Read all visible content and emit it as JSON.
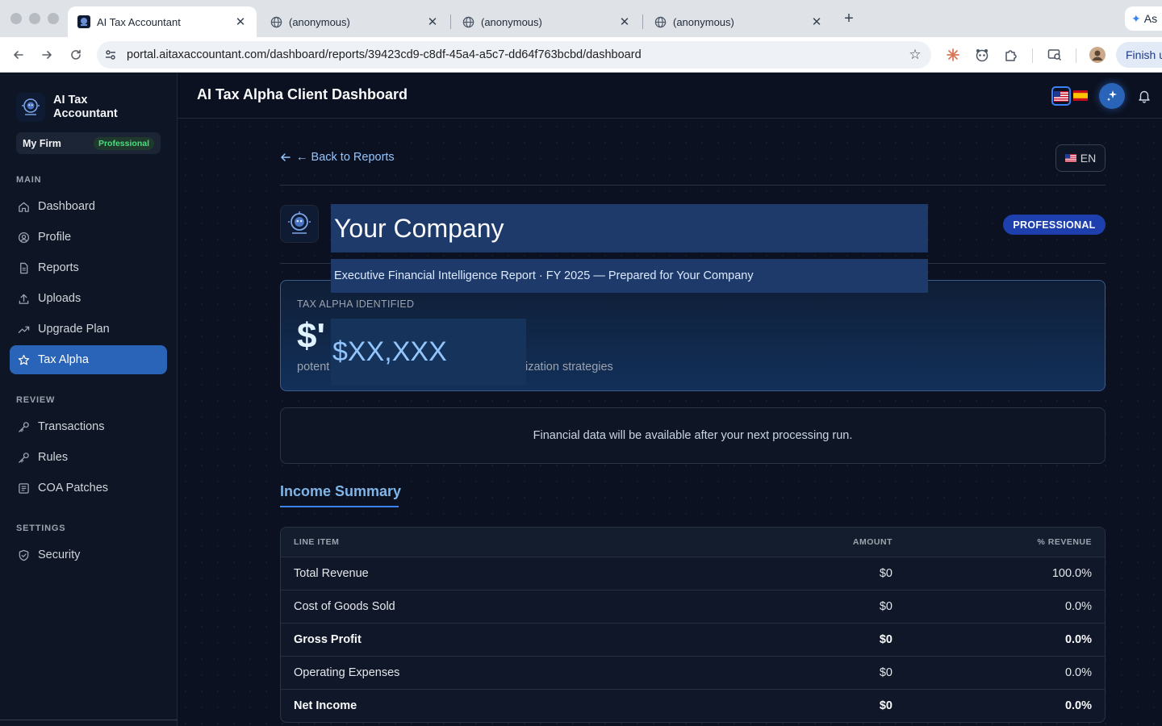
{
  "browser": {
    "tabs": [
      {
        "title": "AI Tax Accountant",
        "active": true
      },
      {
        "title": "(anonymous)",
        "active": false
      },
      {
        "title": "(anonymous)",
        "active": false
      },
      {
        "title": "(anonymous)",
        "active": false
      }
    ],
    "url": "portal.aitaxaccountant.com/dashboard/reports/39423cd9-c8df-45a4-a5c7-dd64f763bcbd/dashboard",
    "assistant_tab": "As",
    "finish_button": "Finish u"
  },
  "sidebar": {
    "brand": "AI Tax Accountant",
    "firm_name": "My Firm",
    "firm_plan": "Professional",
    "sections": {
      "main": "MAIN",
      "review": "REVIEW",
      "settings": "SETTINGS"
    },
    "main_items": [
      {
        "label": "Dashboard",
        "icon": "home-icon"
      },
      {
        "label": "Profile",
        "icon": "user-circle-icon"
      },
      {
        "label": "Reports",
        "icon": "document-icon"
      },
      {
        "label": "Uploads",
        "icon": "upload-icon"
      },
      {
        "label": "Upgrade Plan",
        "icon": "trending-up-icon"
      },
      {
        "label": "Tax Alpha",
        "icon": "star-icon",
        "active": true
      }
    ],
    "review_items": [
      {
        "label": "Transactions",
        "icon": "key-icon"
      },
      {
        "label": "Rules",
        "icon": "key-icon"
      },
      {
        "label": "COA Patches",
        "icon": "list-icon"
      }
    ],
    "settings_items": [
      {
        "label": "Security",
        "icon": "shield-icon"
      }
    ]
  },
  "header": {
    "title": "AI Tax Alpha Client Dashboard"
  },
  "report": {
    "back_link": "← Back to Reports",
    "language": "EN",
    "company_name": "Your Company",
    "subtitle": "Executive Financial Intelligence Report · FY 2025 — Prepared for Your Company",
    "plan_badge": "PROFESSIONAL",
    "tax_alpha": {
      "label": "TAX ALPHA IDENTIFIED",
      "value_partial": "$'",
      "overlay_value": "$XX,XXX",
      "caption_left": "potent",
      "caption_right": "ization strategies"
    },
    "notice": "Financial data will be available after your next processing run.",
    "income_summary": {
      "title": "Income Summary",
      "columns": [
        "LINE ITEM",
        "AMOUNT",
        "% REVENUE"
      ],
      "rows": [
        {
          "item": "Total Revenue",
          "amount": "$0",
          "pct": "100.0%",
          "bold": false
        },
        {
          "item": "Cost of Goods Sold",
          "amount": "$0",
          "pct": "0.0%",
          "bold": false
        },
        {
          "item": "Gross Profit",
          "amount": "$0",
          "pct": "0.0%",
          "bold": true
        },
        {
          "item": "Operating Expenses",
          "amount": "$0",
          "pct": "0.0%",
          "bold": false
        },
        {
          "item": "Net Income",
          "amount": "$0",
          "pct": "0.0%",
          "bold": true
        }
      ]
    }
  },
  "colors": {
    "accent": "#2a64b8",
    "page_bg": "#0b1120",
    "sidebar_bg": "#0e1524",
    "highlight_box": "#1e3a6b",
    "link": "#93c5fd"
  }
}
